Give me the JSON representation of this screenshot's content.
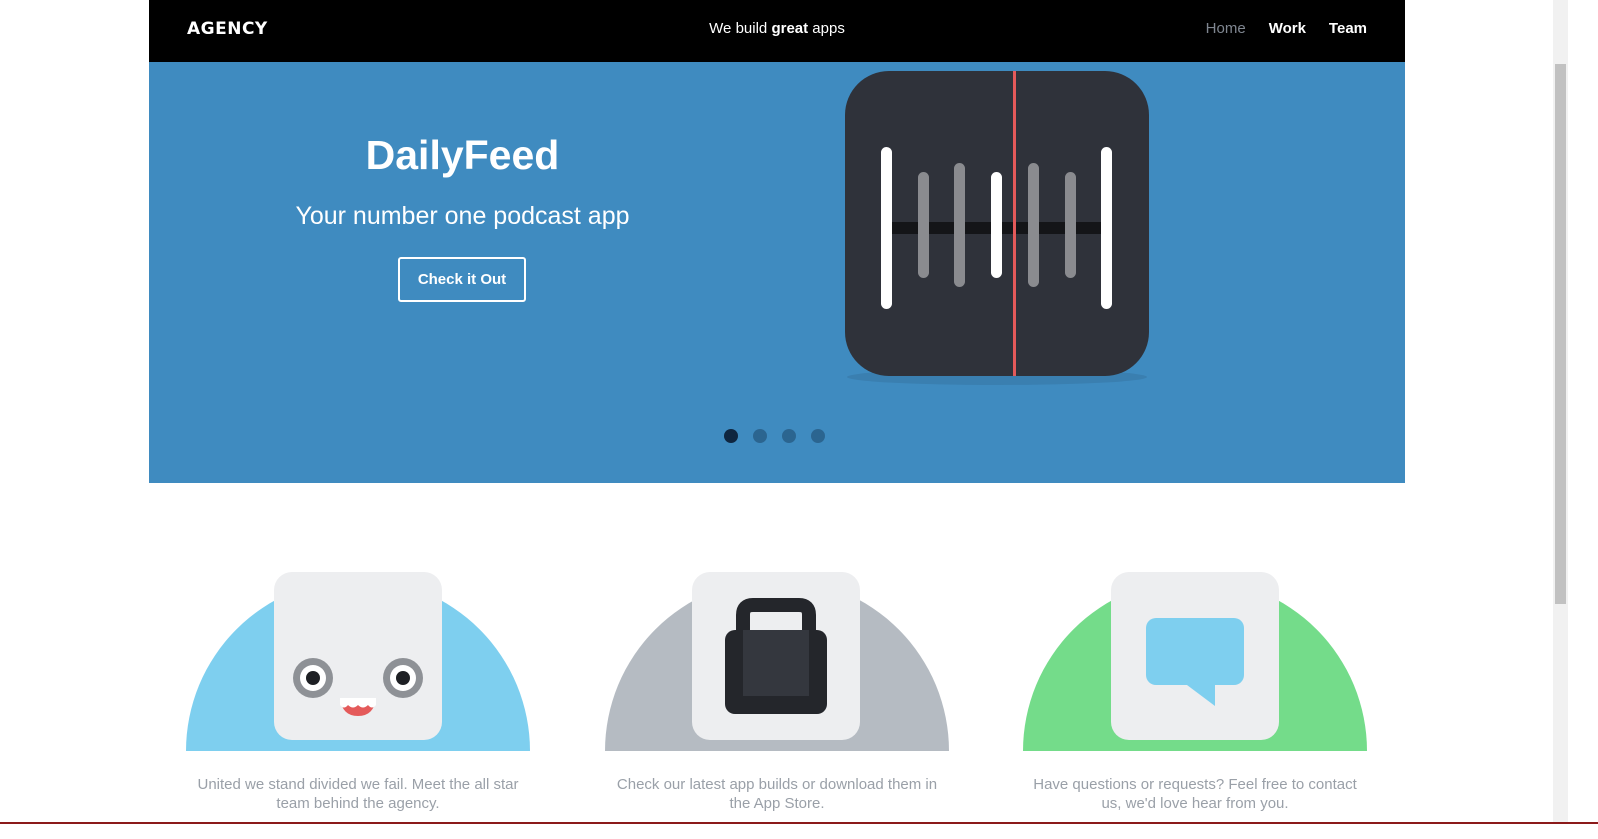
{
  "header": {
    "brand": "AGENCY",
    "tagline_prefix": "We build",
    "tagline_bold": "great",
    "tagline_suffix": "apps",
    "nav": [
      "Home",
      "Work",
      "Team"
    ]
  },
  "hero": {
    "title": "DailyFeed",
    "subtitle": "Your number one podcast app",
    "button": "Check it Out",
    "slides": 4,
    "active_slide": 1,
    "background": "#3f8bc0"
  },
  "features": [
    {
      "icon": "smiley-face-icon",
      "color": "#7ecfef",
      "text": "United we stand divided we fail. Meet the all star team behind the agency."
    },
    {
      "icon": "shopping-bag-icon",
      "color": "#b5bbc2",
      "text": "Check our latest app builds or download them in the App Store."
    },
    {
      "icon": "speech-bubble-icon",
      "color": "#74dc8a",
      "text": "Have questions or requests? Feel free to contact us, we'd love hear from you."
    }
  ]
}
